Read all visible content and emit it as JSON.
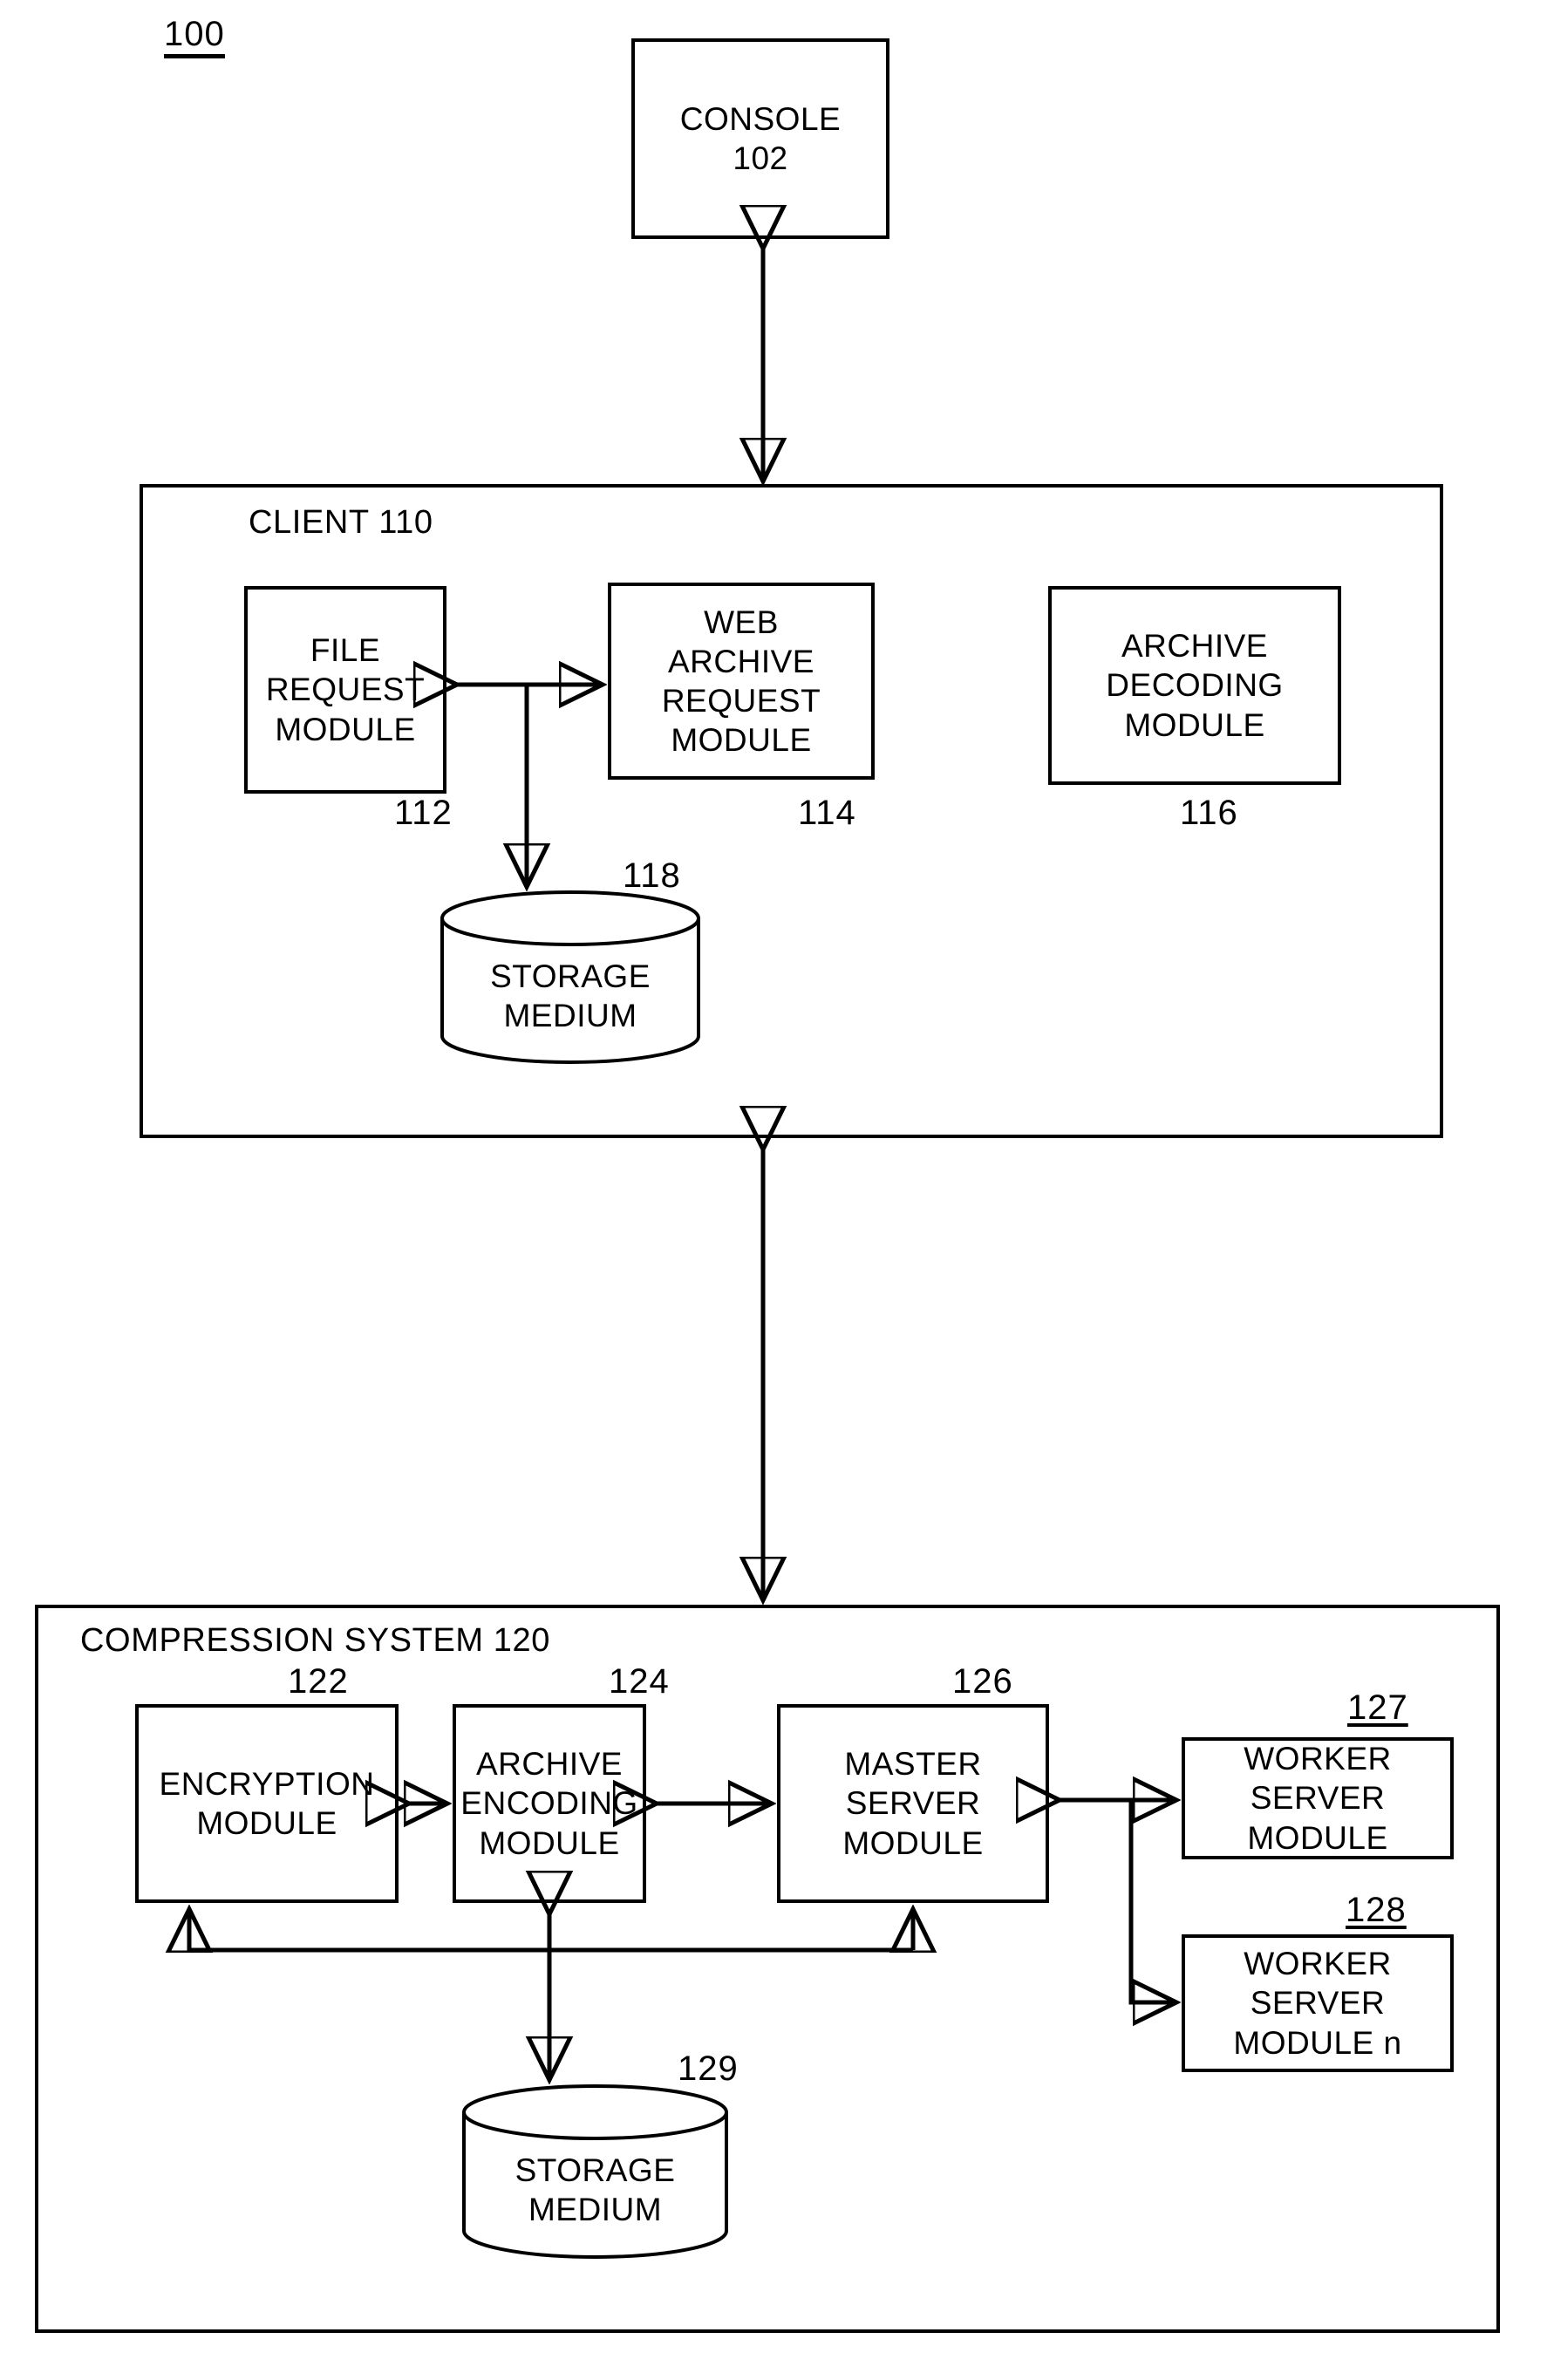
{
  "figure": {
    "number": "100"
  },
  "console": {
    "title": "CONSOLE",
    "ref": "102",
    "label": "CONSOLE\n102"
  },
  "client": {
    "label": "CLIENT 110",
    "modules": [
      {
        "name": "FILE REQUEST MODULE",
        "ref": "112"
      },
      {
        "name": "WEB ARCHIVE REQUEST MODULE",
        "ref": "114"
      },
      {
        "name": "ARCHIVE DECODING MODULE",
        "ref": "116"
      }
    ],
    "storage": {
      "name": "STORAGE MEDIUM",
      "ref": "118"
    }
  },
  "compression_system": {
    "label": "COMPRESSION SYSTEM 120",
    "modules": [
      {
        "name": "ENCRYPTION MODULE",
        "ref": "122"
      },
      {
        "name": "ARCHIVE ENCODING MODULE",
        "ref": "124"
      },
      {
        "name": "MASTER SERVER MODULE",
        "ref": "126"
      },
      {
        "name": "WORKER SERVER MODULE",
        "ref": "127"
      },
      {
        "name": "WORKER SERVER MODULE n",
        "ref": "128"
      }
    ],
    "storage": {
      "name": "STORAGE MEDIUM",
      "ref": "129"
    }
  },
  "module_lines": {
    "console": [
      "CONSOLE",
      "102"
    ],
    "file_request": [
      "FILE",
      "REQUEST",
      "MODULE"
    ],
    "web_archive": [
      "WEB",
      "ARCHIVE",
      "REQUEST",
      "MODULE"
    ],
    "archive_decoding": [
      "ARCHIVE",
      "DECODING",
      "MODULE"
    ],
    "storage": [
      "STORAGE",
      "MEDIUM"
    ],
    "encryption": [
      "ENCRYPTION",
      "MODULE"
    ],
    "archive_encoding": [
      "ARCHIVE",
      "ENCODING",
      "MODULE"
    ],
    "master_server": [
      "MASTER",
      "SERVER",
      "MODULE"
    ],
    "worker_server": [
      "WORKER",
      "SERVER",
      "MODULE"
    ],
    "worker_server_n": [
      "WORKER",
      "SERVER",
      "MODULE n"
    ]
  },
  "colors": {
    "ink": "#000000",
    "paper": "#ffffff"
  }
}
